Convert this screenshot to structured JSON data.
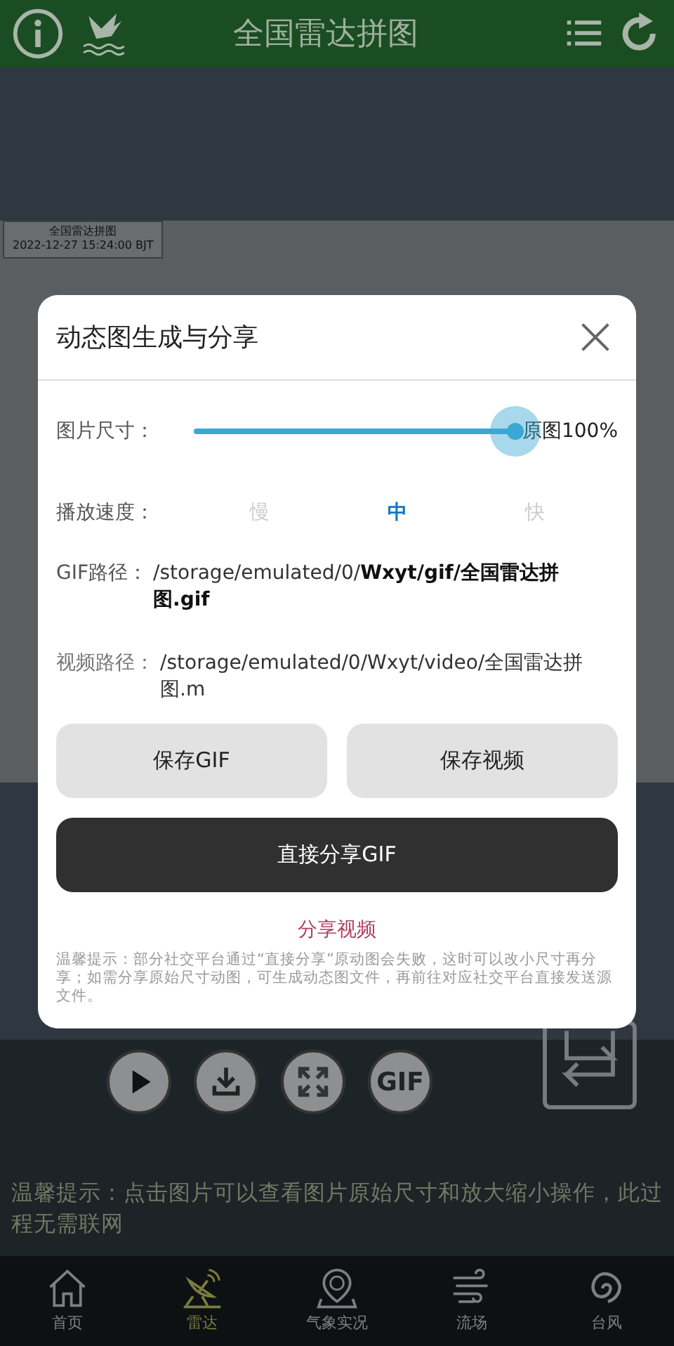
{
  "top_bar": {
    "title": "全国雷达拼图"
  },
  "map": {
    "title": "全国雷达拼图",
    "timestamp": "2022-12-27 15:24:00 BJT"
  },
  "media_buttons": [
    {
      "kind": "play"
    },
    {
      "kind": "download"
    },
    {
      "kind": "expand"
    },
    {
      "kind": "text",
      "label": "GIF"
    }
  ],
  "hint": "温馨提示：点击图片可以查看图片原始尺寸和放大缩小操作，此过程无需联网",
  "bottom_nav": [
    {
      "kind": "home",
      "label": "首页",
      "selected": false
    },
    {
      "kind": "radar",
      "label": "雷达",
      "selected": true
    },
    {
      "kind": "weather",
      "label": "气象实况",
      "selected": false
    },
    {
      "kind": "wind",
      "label": "流场",
      "selected": false
    },
    {
      "kind": "typhoon",
      "label": "台风",
      "selected": false
    }
  ],
  "dialog": {
    "title": "动态图生成与分享",
    "size": {
      "label": "图片尺寸：",
      "level": 1,
      "reading": "原图100%"
    },
    "speed": {
      "label": "播放速度：",
      "options": [
        {
          "label": "慢",
          "selected": false
        },
        {
          "label": "中",
          "selected": true
        },
        {
          "label": "快",
          "selected": false
        }
      ]
    },
    "gif_path": {
      "label": "GIF路径：",
      "value": "/storage/emulated/0/**Wxyt/gif/全国雷达拼图.gif**"
    },
    "video_path": {
      "label": "视频路径：",
      "value": "/storage/emulated/0/Wxyt/video/全国雷达拼图.m"
    },
    "buttons": [
      {
        "kind": "secondary",
        "label": "保存GIF"
      },
      {
        "kind": "secondary",
        "label": "保存视频"
      },
      {
        "kind": "primary",
        "label": "直接分享GIF"
      },
      {
        "kind": "link",
        "label": "分享视频"
      }
    ],
    "note": "温馨提示：部分社交平台通过“直接分享”原动图会失败，这时可以改小尺寸再分享；如需分享原始尺寸动图，可生成动态图文件，再前往对应社交平台直接发送源文件。"
  }
}
